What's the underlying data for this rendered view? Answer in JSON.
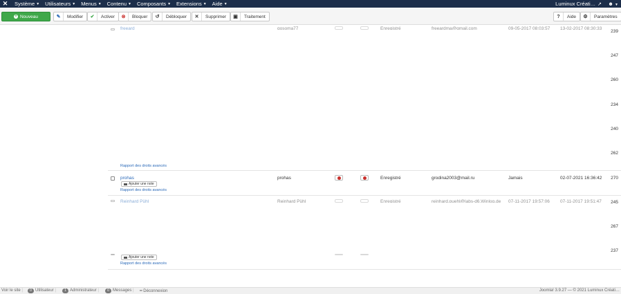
{
  "topbar": {
    "logo_glyph": "✕",
    "menu": [
      {
        "label": "Système"
      },
      {
        "label": "Utilisateurs"
      },
      {
        "label": "Menus"
      },
      {
        "label": "Contenu"
      },
      {
        "label": "Composants"
      },
      {
        "label": "Extensions"
      },
      {
        "label": "Aide"
      }
    ],
    "site_name": "Luminux Créati…",
    "user_glyph": "👤"
  },
  "toolbar": {
    "new_label": "Nouveau",
    "edit_label": "Modifier",
    "activate_label": "Activer",
    "block_label": "Bloquer",
    "unblock_label": "Débloquer",
    "delete_label": "Supprimer",
    "batch_label": "Traitement",
    "help_label": "Aide",
    "options_label": "Paramètres"
  },
  "rows": {
    "top_partial": {
      "name": "freeard",
      "username": "gosoma77",
      "group": "Enregistré",
      "email": "freeardma@gmail.com",
      "last_visit": "09-05-2017 08:03:57",
      "registered": "13-02-2017 08:30:33",
      "id": "239"
    },
    "ids_column_a": [
      "247",
      "260",
      "234",
      "240",
      "262"
    ],
    "acl_link_1": "Rapport des droits avancés",
    "prohas": {
      "name": "prohas",
      "username": "prohas",
      "group": "Enregistré",
      "email": "grodina2003@mail.ru",
      "last_visit": "Jamais",
      "registered": "02-07-2021 16:36:42",
      "id": "270",
      "note_label": "Ajouter une note",
      "acl_label": "Rapport des droits avancés"
    },
    "reinhard_partial": {
      "name": "Reinhard Pühl",
      "username": "Reinhard Pühl",
      "group": "Enregistré",
      "email": "reinhard.puehl@labs-d6.Winlog.de",
      "last_visit": "07-11-2017 19:57:06",
      "registered": "07-11-2017 19:51:47",
      "id": "245"
    },
    "ids_column_b": [
      "267",
      "237"
    ],
    "bottom_note_label": "Ajouter une note",
    "bottom_acl_label": "Rapport des droits avancés"
  },
  "footer": {
    "view_site": "Voir le site",
    "users_count": "0",
    "users_label": "Utilisateur",
    "admins_count": "1",
    "admins_label": "Administrateur",
    "messages_count": "0",
    "messages_label": "Messages",
    "logout_label": "Déconnexion",
    "version_text": "Joomla! 3.9.27 — © 2021 Luminux Créati…"
  }
}
